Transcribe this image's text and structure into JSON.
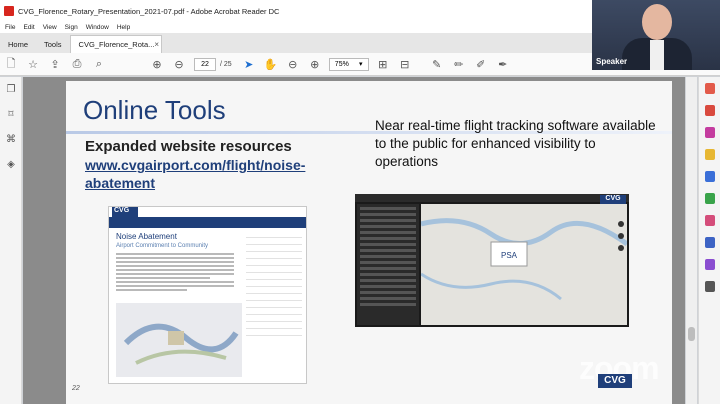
{
  "window": {
    "title": "CVG_Florence_Rotary_Presentation_2021-07.pdf - Adobe Acrobat Reader DC"
  },
  "menu": [
    "File",
    "Edit",
    "View",
    "Sign",
    "Window",
    "Help"
  ],
  "tabs": {
    "home": "Home",
    "tools": "Tools",
    "document": "CVG_Florence_Rota..."
  },
  "toolbar": {
    "current_page": "22",
    "total_pages": "/ 25",
    "zoom": "75%"
  },
  "speaker": {
    "label": "Speaker"
  },
  "slide": {
    "title": "Online Tools",
    "left_heading": "Expanded website resources",
    "link": "www.cvgairport.com/flight/noise-abatement",
    "right_text": "Near real-time flight tracking software available to the public for enhanced visibility to operations",
    "page_number": "22",
    "webpage": {
      "logo": "CVG",
      "title": "Noise Abatement",
      "subtitle": "Airport Commitment to Community"
    },
    "tracker": {
      "logo": "CVG",
      "tag": "PSA"
    }
  },
  "watermark": {
    "text": "zoom",
    "cvg": "CVG"
  },
  "colors": {
    "accent": "#1f3f7a",
    "brand_red": "#d7261e"
  }
}
